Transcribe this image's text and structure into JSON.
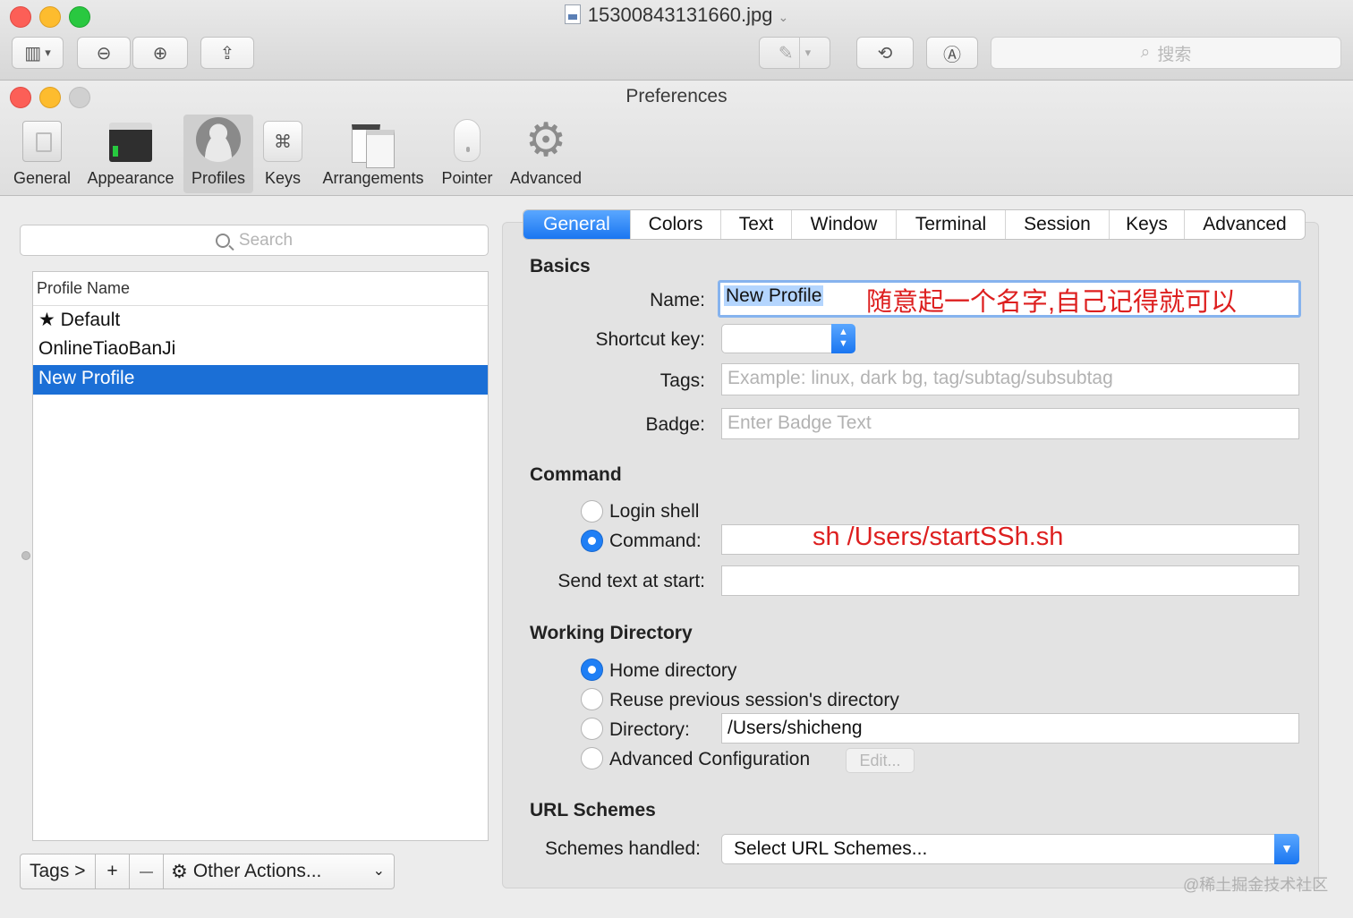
{
  "preview": {
    "file_title": "15300843131660.jpg",
    "search_placeholder": "搜索"
  },
  "prefs": {
    "title": "Preferences",
    "tabs": [
      "General",
      "Appearance",
      "Profiles",
      "Keys",
      "Arrangements",
      "Pointer",
      "Advanced"
    ],
    "active_tab": "Profiles"
  },
  "profiles": {
    "search_placeholder": "Search",
    "column_header": "Profile Name",
    "items": [
      "★ Default",
      "OnlineTiaoBanJi",
      "New Profile"
    ],
    "selected": "New Profile",
    "bottom_bar": {
      "tags": "Tags >",
      "add": "+",
      "remove": "—",
      "other_actions": "Other Actions..."
    }
  },
  "profile_tabs": {
    "items": [
      "General",
      "Colors",
      "Text",
      "Window",
      "Terminal",
      "Session",
      "Keys",
      "Advanced"
    ],
    "active": "General"
  },
  "basics": {
    "heading": "Basics",
    "name_label": "Name:",
    "name_value": "New Profile",
    "name_annotation": "随意起一个名字,自己记得就可以",
    "shortcut_label": "Shortcut key:",
    "tags_label": "Tags:",
    "tags_placeholder": "Example: linux, dark bg, tag/subtag/subsubtag",
    "badge_label": "Badge:",
    "badge_placeholder": "Enter Badge Text"
  },
  "command": {
    "heading": "Command",
    "login_shell": "Login shell",
    "command_label": "Command:",
    "command_value": "sh /Users/startSSh.sh",
    "send_text_label": "Send text at start:",
    "send_text_value": "",
    "selected": "Command"
  },
  "working_directory": {
    "heading": "Working Directory",
    "home": "Home directory",
    "reuse": "Reuse previous session's directory",
    "directory_label": "Directory:",
    "directory_value": "/Users/shicheng",
    "advanced": "Advanced Configuration",
    "edit_button": "Edit...",
    "selected": "Home directory"
  },
  "url_schemes": {
    "heading": "URL Schemes",
    "label": "Schemes handled:",
    "value": "Select URL Schemes..."
  },
  "watermark": "@稀土掘金技术社区",
  "colors": {
    "accent": "#1a76f1",
    "selection": "#1b6fd6",
    "annotation_red": "#dd1f1f"
  }
}
